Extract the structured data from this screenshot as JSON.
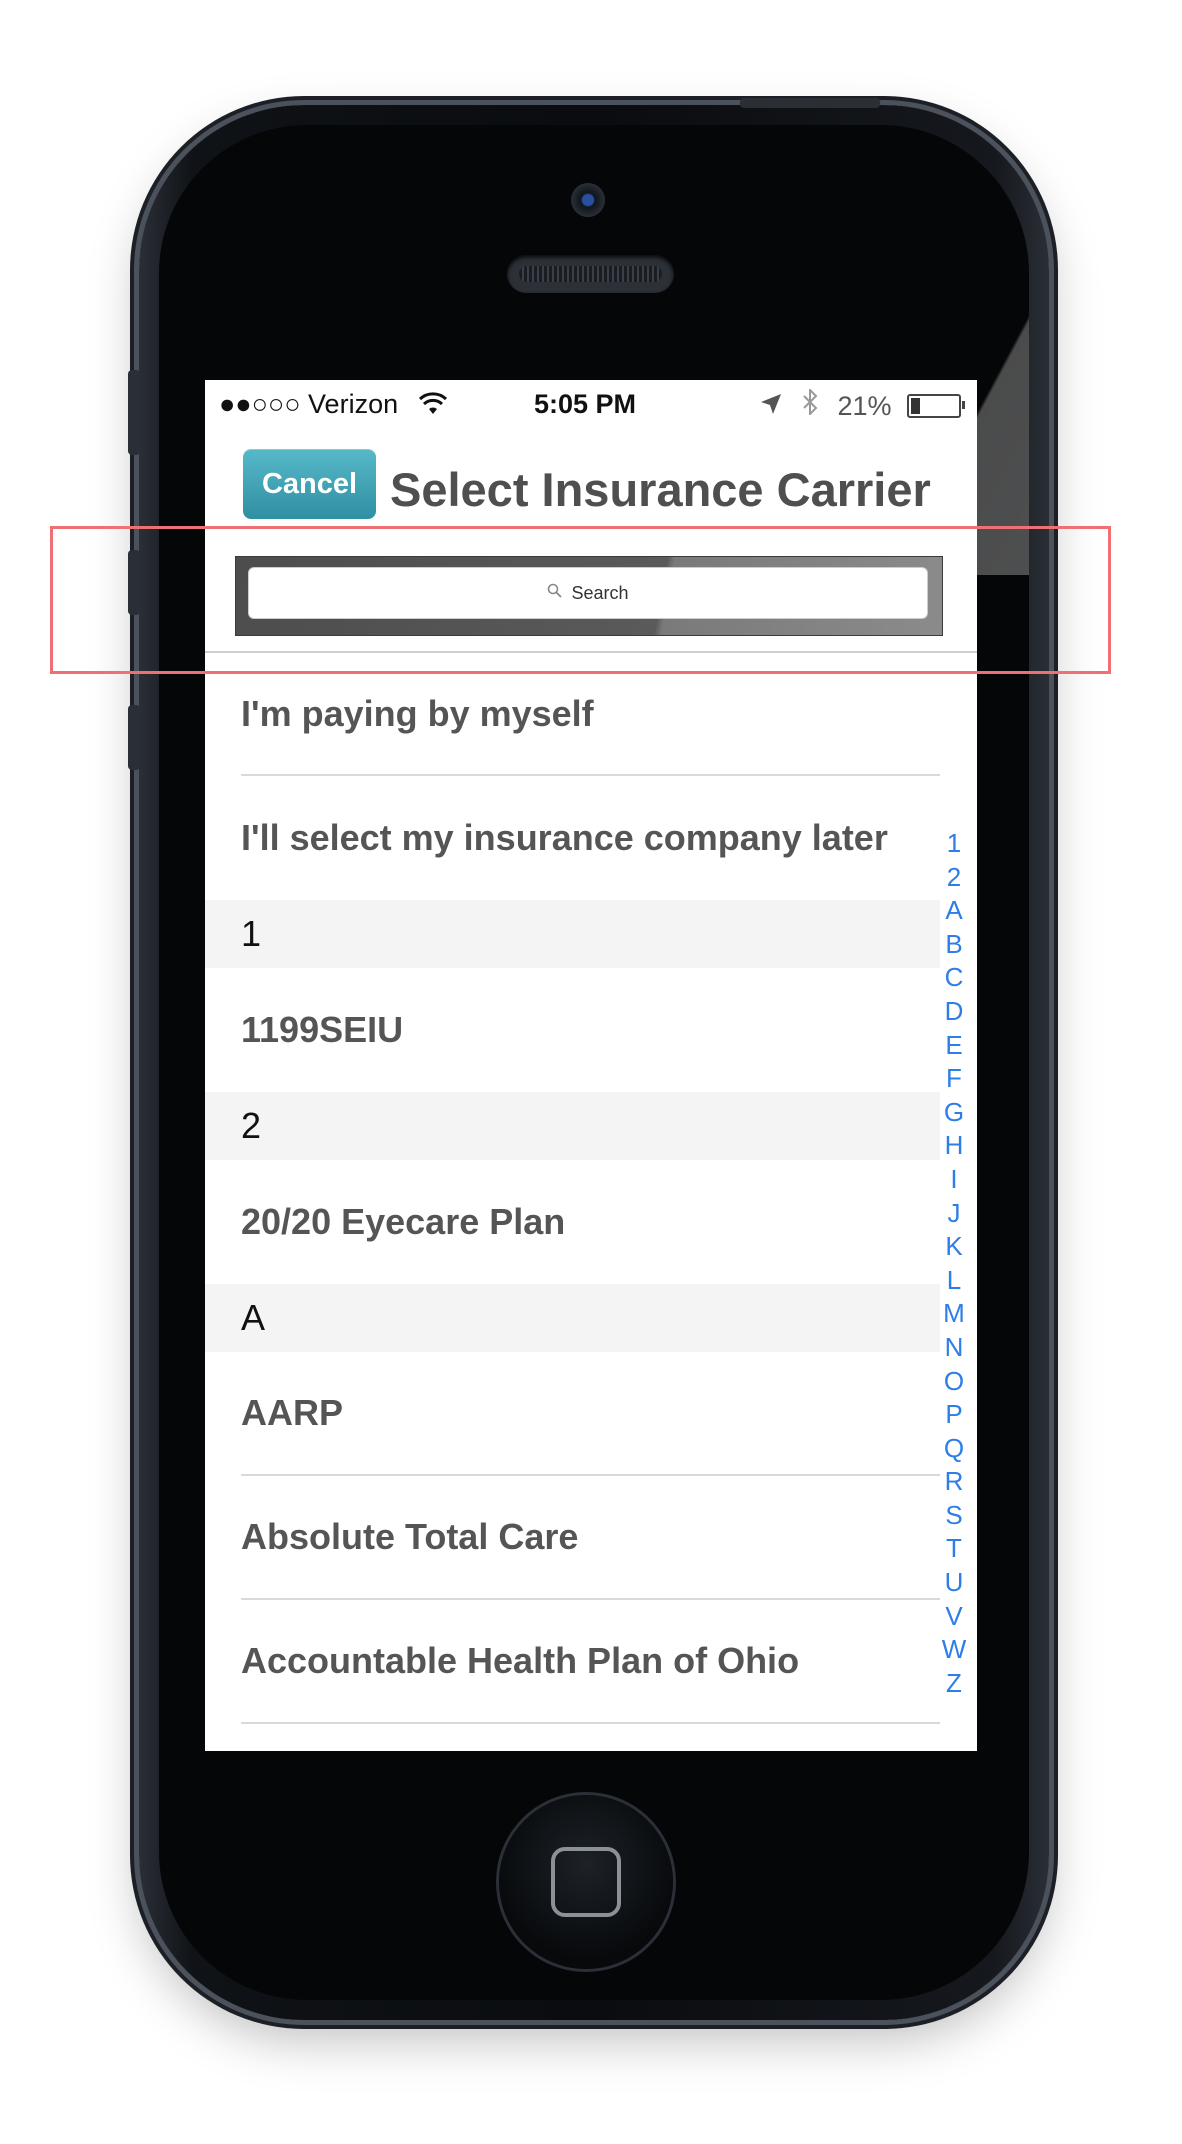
{
  "status_bar": {
    "carrier": "●●○○○ Verizon",
    "time": "5:05 PM",
    "battery": "21%",
    "battery_level": 0.21
  },
  "nav": {
    "cancel_label": "Cancel",
    "title": "Select Insurance Carrier"
  },
  "search": {
    "placeholder": "Search"
  },
  "list": {
    "top_items": [
      "I'm paying by myself",
      "I'll select my insurance company later"
    ],
    "sections": [
      {
        "header": "1",
        "items": [
          "1199SEIU"
        ]
      },
      {
        "header": "2",
        "items": [
          "20/20 Eyecare Plan"
        ]
      },
      {
        "header": "A",
        "items": [
          "AARP",
          "Absolute Total Care",
          "Accountable Health Plan of Ohio"
        ]
      }
    ]
  },
  "index_letters": [
    "1",
    "2",
    "A",
    "B",
    "C",
    "D",
    "E",
    "F",
    "G",
    "H",
    "I",
    "J",
    "K",
    "L",
    "M",
    "N",
    "O",
    "P",
    "Q",
    "R",
    "S",
    "T",
    "U",
    "V",
    "W",
    "Z"
  ],
  "colors": {
    "accent": "#3a9fb2",
    "index": "#2d7ee8",
    "highlight": "#ef6f72"
  }
}
